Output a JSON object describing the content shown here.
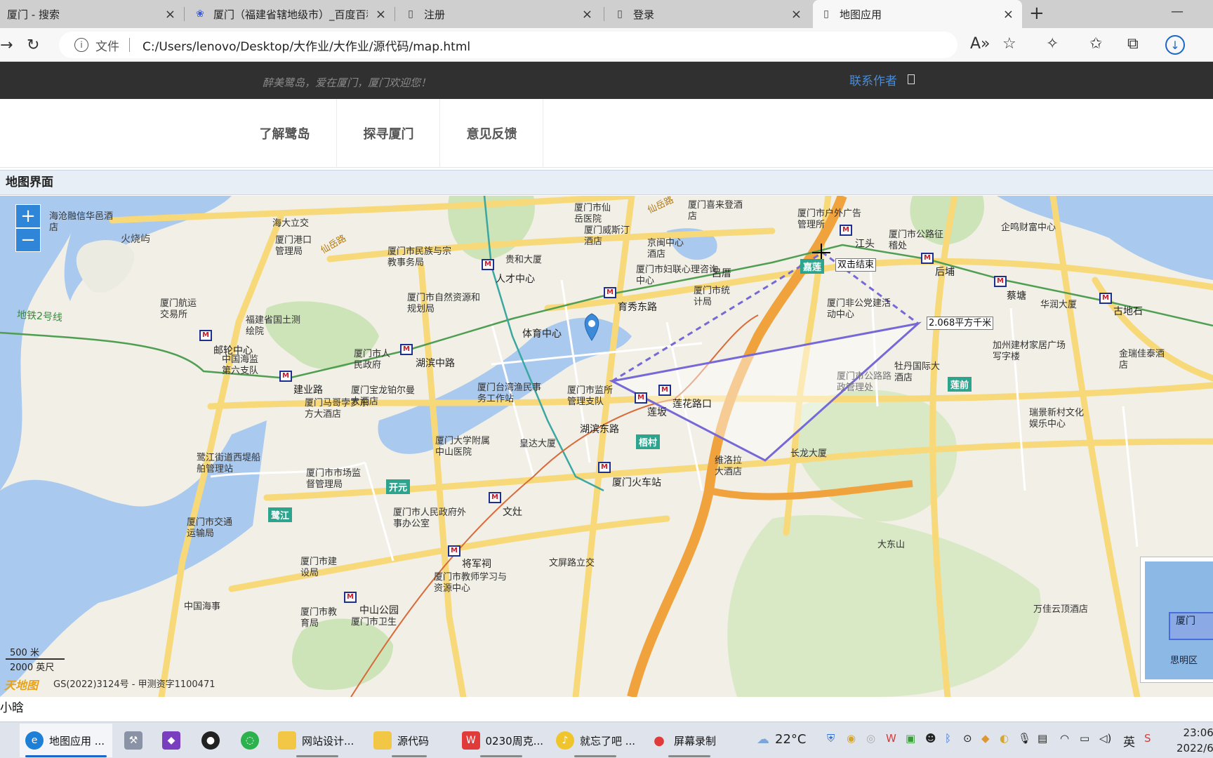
{
  "browser": {
    "tabs": [
      {
        "label": "厦门 - 搜索",
        "icon": "search-icon"
      },
      {
        "label": "厦门（福建省辖地级市）_百度百科",
        "icon": "baidu-paw-icon"
      },
      {
        "label": "注册",
        "icon": "page-icon"
      },
      {
        "label": "登录",
        "icon": "page-icon"
      },
      {
        "label": "地图应用",
        "icon": "page-icon",
        "active": true
      }
    ],
    "address": {
      "security_label": "文件",
      "url": "C:/Users/lenovo/Desktop/大作业/大作业/源代码/map.html"
    }
  },
  "site": {
    "welcome": "醉美鹭岛，爱在厦门，厦门欢迎您！",
    "contact": "联系作者",
    "nav": [
      "了解鹭岛",
      "探寻厦门",
      "意见反馈"
    ],
    "panel_title": "地图界面",
    "footer": "小晗"
  },
  "map": {
    "zoom_in": "+",
    "zoom_out": "−",
    "scale_metric": "500 米",
    "scale_imperial": "2000 英尺",
    "copyright": "GS(2022)3124号 - 甲测资字1100471",
    "logo": "天地图",
    "area_label": "2.068平方千米",
    "end_hint": "双击结束",
    "overview_label": "厦门",
    "overview_district": "思明区",
    "labels": [
      "海沧融信华邑酒店",
      "海大立交",
      "火烧屿",
      "厦门港口管理局",
      "仙岳路",
      "厦门市民族与宗教事务局",
      "贵和大厦",
      "人才中心",
      "厦门市仙岳医院",
      "仙岳路",
      "厦门喜来登酒店",
      "厦门市户外广告管理所",
      "江头",
      "厦门市公路征稽处",
      "企鸣财富中心",
      "后埔",
      "蔡塘",
      "华润大厦",
      "古地石",
      "厦门威斯汀酒店",
      "京闽中心酒店",
      "厦门市妇联心理咨询中心",
      "吕厝",
      "厦门市统计局",
      "厦门市自然资源和规划局",
      "育秀东路",
      "厦门航运交易所",
      "福建省国土测绘院",
      "体育中心",
      "厦门非公党建活动中心",
      "邮轮中心",
      "中国海监第六支队",
      "厦门市人民政府",
      "湖滨中路",
      "厦门台湾渔民事务工作站",
      "厦门市监所管理支队",
      "加州建材家居广场写字楼",
      "金瑞佳泰酒店",
      "建业路",
      "厦门宝龙铂尔曼大酒店",
      "厦门马哥孛罗东方大酒店",
      "莲花路口",
      "莲坂",
      "厦门市公路路政管理处",
      "牡丹国际大酒店",
      "瑞景新村文化娱乐中心",
      "厦门大学附属中山医院",
      "皇达大厦",
      "湖滨东路",
      "梧村",
      "鹭江街道西堤船舶管理站",
      "厦门市市场监督管理局",
      "开元",
      "维洛拉大酒店",
      "长龙大厦",
      "厦门火车站",
      "鹭江",
      "厦门市人民政府外事办公室",
      "文灶",
      "厦门市交通运输局",
      "厦门市建设局",
      "将军祠",
      "文屏路立交",
      "厦门市教师学习与资源中心",
      "大东山",
      "中国海事",
      "厦门市教育局",
      "中山公园",
      "厦门市卫生",
      "万佳云顶酒店",
      "地铁2号线",
      "嘉莲",
      "莲前"
    ]
  },
  "taskbar": {
    "items": [
      {
        "label": "地图应用 ...",
        "icon": "edge-icon",
        "active": true
      },
      {
        "label": "",
        "icon": "tool-icon"
      },
      {
        "label": "",
        "icon": "visual-studio-icon"
      },
      {
        "label": "",
        "icon": "qq-icon"
      },
      {
        "label": "",
        "icon": "wechat-icon"
      },
      {
        "label": "网站设计...",
        "icon": "folder-icon"
      },
      {
        "label": "源代码",
        "icon": "folder-icon"
      },
      {
        "label": "0230周克...",
        "icon": "wps-icon"
      },
      {
        "label": "就忘了吧 ...",
        "icon": "music-icon"
      },
      {
        "label": "屏幕录制",
        "icon": "record-icon"
      }
    ],
    "weather": "22°C",
    "ime": "英",
    "time": "23:06",
    "date": "2022/6"
  },
  "colors": {
    "header_bg": "#303030",
    "link_blue": "#4a8bd6",
    "polygon": "#7668d6",
    "water": "#a9c9ef",
    "road_yellow": "#f8d97a",
    "highway_orange": "#f0a23d"
  }
}
